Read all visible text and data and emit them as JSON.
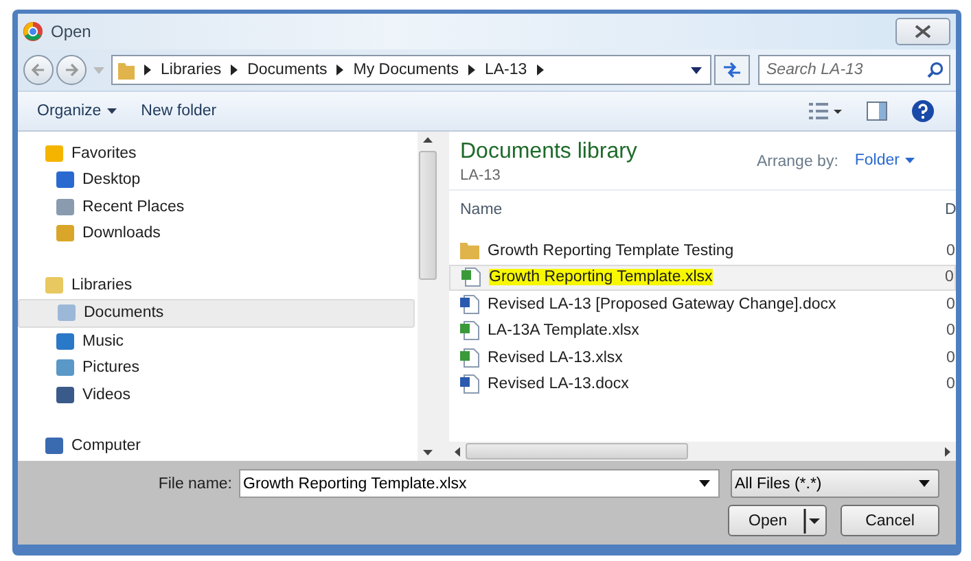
{
  "window": {
    "title": "Open"
  },
  "address": {
    "crumbs": [
      "Libraries",
      "Documents",
      "My Documents",
      "LA-13"
    ]
  },
  "search": {
    "placeholder": "Search LA-13"
  },
  "toolbar": {
    "organize": "Organize",
    "new_folder": "New folder"
  },
  "nav": {
    "groups": [
      {
        "label": "Favorites",
        "kind": "star",
        "children": [
          {
            "label": "Desktop",
            "kind": "desktop",
            "selected": false
          },
          {
            "label": "Recent Places",
            "kind": "recent",
            "selected": false
          },
          {
            "label": "Downloads",
            "kind": "downloads",
            "selected": false
          }
        ]
      },
      {
        "label": "Libraries",
        "kind": "library",
        "children": [
          {
            "label": "Documents",
            "kind": "documents",
            "selected": true
          },
          {
            "label": "Music",
            "kind": "music",
            "selected": false
          },
          {
            "label": "Pictures",
            "kind": "pictures",
            "selected": false
          },
          {
            "label": "Videos",
            "kind": "videos",
            "selected": false
          }
        ]
      },
      {
        "label": "Computer",
        "kind": "computer"
      }
    ]
  },
  "content": {
    "title": "Documents library",
    "subtitle": "LA-13",
    "arrange_label": "Arrange by:",
    "arrange_value": "Folder",
    "columns": [
      "Name",
      "D"
    ],
    "files": [
      {
        "name": "Growth Reporting Template Testing",
        "kind": "folder",
        "column_2": "0",
        "selected": false,
        "highlighted": false
      },
      {
        "name": "Growth Reporting Template.xlsx",
        "kind": "xlsx",
        "column_2": "0",
        "selected": true,
        "highlighted": true
      },
      {
        "name": "Revised LA-13 [Proposed Gateway Change].docx",
        "kind": "docx",
        "column_2": "0",
        "selected": false,
        "highlighted": false
      },
      {
        "name": "LA-13A Template.xlsx",
        "kind": "xlsx",
        "column_2": "0",
        "selected": false,
        "highlighted": false
      },
      {
        "name": "Revised LA-13.xlsx",
        "kind": "xlsx",
        "column_2": "0",
        "selected": false,
        "highlighted": false
      },
      {
        "name": "Revised LA-13.docx",
        "kind": "docx",
        "column_2": "0",
        "selected": false,
        "highlighted": false
      }
    ]
  },
  "footer": {
    "file_name_label": "File name:",
    "file_name": "Growth Reporting Template.xlsx",
    "filter": "All Files (*.*)",
    "buttons": [
      {
        "label": "Open",
        "split": true
      },
      {
        "label": "Cancel",
        "split": false
      }
    ]
  }
}
